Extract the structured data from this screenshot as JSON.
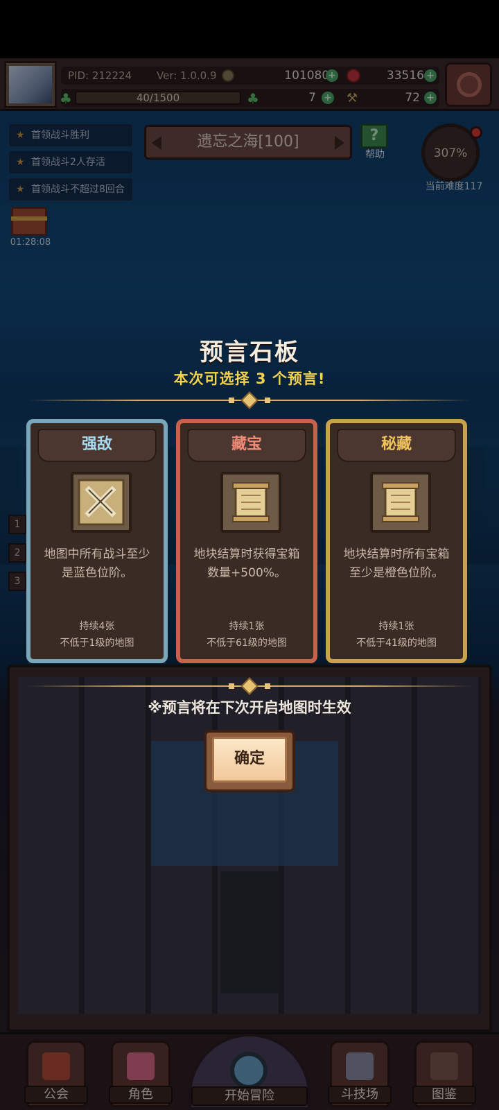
{
  "hud": {
    "pid": "PID: 212224",
    "version": "Ver: 1.0.0.9",
    "gold": "1010803",
    "gems": "33516",
    "energy": "40/1500",
    "energy_fraction": 0.0267,
    "clovers": "7",
    "hammers": "72",
    "plus": "+"
  },
  "quests": [
    "首领战斗胜利",
    "首领战斗2人存活",
    "首领战斗不超过8回合"
  ],
  "chest_timer": "01:28:08",
  "map": {
    "title": "遗忘之海[100]",
    "help_label": "帮助",
    "difficulty_percent": "307%",
    "difficulty_label": "当前难度117"
  },
  "side_numbers": [
    "1",
    "2",
    "3"
  ],
  "dialog": {
    "title": "预言石板",
    "subtitle": "本次可选择 3 个预言!",
    "cards": [
      {
        "header": "强敌",
        "icon": "crossed-swords-icon",
        "desc_line1": "地图中所有战斗至少",
        "desc_line2": "是蓝色位阶。",
        "duration": "持续4张",
        "requirement": "不低于1级的地图"
      },
      {
        "header": "藏宝",
        "icon": "scroll-icon",
        "desc_line1": "地块结算时获得宝箱",
        "desc_line2": "数量+500%。",
        "duration": "持续1张",
        "requirement": "不低于61级的地图"
      },
      {
        "header": "秘藏",
        "icon": "scroll-icon",
        "desc_line1": "地块结算时所有宝箱",
        "desc_line2": "至少是橙色位阶。",
        "duration": "持续1张",
        "requirement": "不低于41级的地图"
      }
    ],
    "notice": "※预言将在下次开启地图时生效",
    "confirm_label": "确定"
  },
  "bottom_nav": {
    "guild": "公会",
    "character": "角色",
    "start": "开始冒险",
    "arena": "斗技场",
    "codex": "图鉴"
  },
  "colors": {
    "blue_tier": "#7aa7b9",
    "red_tier": "#c9624a",
    "gold_tier": "#c9a34a",
    "subtitle_yellow": "#f2d34e"
  }
}
